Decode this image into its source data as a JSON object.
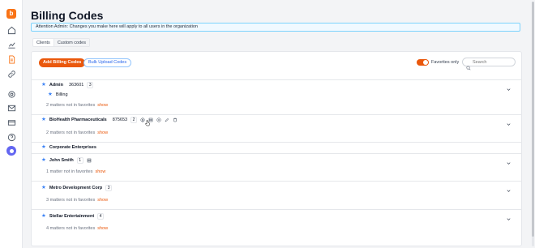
{
  "page": {
    "title": "Billing Codes"
  },
  "alert": {
    "text": "Attention Admin: Changes you make here will apply to all users in the organization"
  },
  "tabs": [
    {
      "label": "Clients"
    },
    {
      "label": "Custom codes"
    }
  ],
  "toolbar": {
    "add_label": "Add Billing Codes",
    "bulk_label": "Bulk Upload Codes",
    "favorites_label": "Favorites only",
    "favorites_on": true,
    "search_placeholder": "Search"
  },
  "clients": [
    {
      "name": "Admin",
      "code": "363601",
      "count": "3",
      "item": "Billing",
      "note": "2 matters not in favorites",
      "show": "show"
    },
    {
      "name": "BioHealth Pharmaceuticals",
      "code": "875653",
      "count": "2",
      "note": "2 matters not in favorites",
      "show": "show"
    },
    {
      "name": "Corporate Enterprises"
    },
    {
      "name": "John Smith",
      "count": "1",
      "note": "1 matter not in favorites",
      "show": "show"
    },
    {
      "name": "Metro Development Corp",
      "count": "3",
      "note": "3 matters not in favorites",
      "show": "show"
    },
    {
      "name": "Stellar Entertainment",
      "count": "4",
      "note": "4 matters not in favorites",
      "show": "show"
    }
  ],
  "colors": {
    "accent": "#ea580c",
    "star": "#3b82f6",
    "alert_border": "#7dd3fc"
  }
}
